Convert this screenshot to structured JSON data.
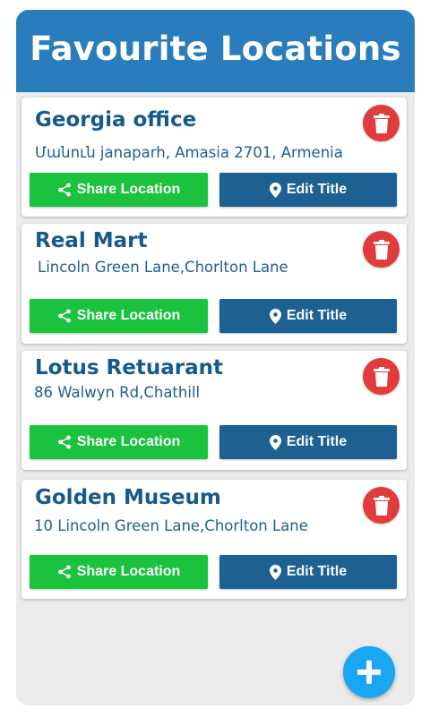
{
  "header": {
    "title": "Favourite Locations"
  },
  "buttons": {
    "share_label": "Share Location",
    "edit_label": "Edit Title"
  },
  "locations": [
    {
      "title": "Georgia office",
      "address": "Մանուն janaparh, Amasia 2701, Armenia"
    },
    {
      "title": "Real Mart",
      "address": "Lincoln Green Lane,Chorlton Lane"
    },
    {
      "title": "Lotus Retuarant",
      "address": "86 Walwyn Rd,Chathill"
    },
    {
      "title": "Golden Museum",
      "address": "10 Lincoln Green Lane,Chorlton Lane"
    }
  ],
  "colors": {
    "header": "#2a7dbd",
    "share_button": "#1ac23d",
    "edit_button": "#1c6192",
    "delete_button": "#e13b3b",
    "fab": "#1aa6f2"
  }
}
